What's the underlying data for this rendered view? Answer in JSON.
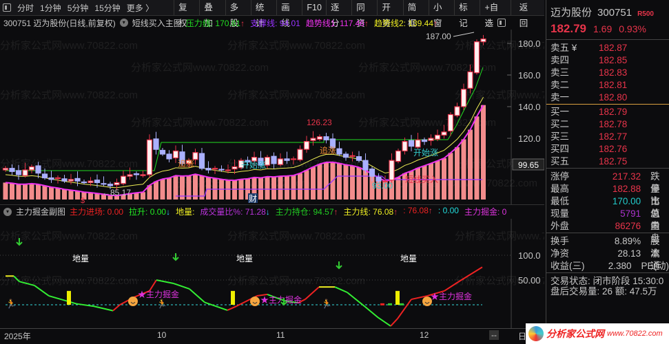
{
  "toolbar": {
    "left": [
      "分时",
      "1分钟",
      "5分钟",
      "15分钟",
      "更多 〉"
    ],
    "buttons": [
      "复权",
      "叠加",
      "多股",
      "统计",
      "画线",
      "F10",
      "逐分",
      "同资",
      "开资",
      "简框",
      "小窗",
      "标记",
      "+自选",
      "返回"
    ]
  },
  "title": {
    "stock": "300751 迈为股份(日线,前复权)",
    "indicator": "短线买入主图",
    "items": [
      {
        "label": "压力线: 170.81",
        "color": "#22dd22",
        "arrow": "↑"
      },
      {
        "label": "支撑线: 94.01",
        "color": "#9933ff",
        "arrow": ""
      },
      {
        "label": "趋势线1: 117.46",
        "color": "#ee33ee",
        "arrow": "↑"
      },
      {
        "label": "趋势线2: 139.44",
        "color": "#eeee22",
        "arrow": "↑"
      }
    ]
  },
  "sub": {
    "indicator": "主力掘金副图",
    "items": [
      {
        "label": "主力进场: 0.00",
        "color": "#ee2222",
        "arrow": ""
      },
      {
        "label": "拉升: 0.00",
        "color": "#22ee22",
        "arrow": "↓"
      },
      {
        "label": "地量:",
        "color": "#eeee22",
        "arrow": ""
      },
      {
        "label": "成交量比%: 71.28",
        "color": "#bb33dd",
        "arrow": "↓"
      },
      {
        "label": "主力持仓: 94.57",
        "color": "#22cc22",
        "arrow": "↑"
      },
      {
        "label": "主力线: 76.08",
        "color": "#eeee22",
        "arrow": "↑"
      },
      {
        "label": ": 76.08",
        "color": "#ee2222",
        "arrow": "↑"
      },
      {
        "label": ": 0.00",
        "color": "#22dddd",
        "arrow": ""
      },
      {
        "label": "主力掘金: 0",
        "color": "#dd33dd",
        "arrow": ""
      }
    ]
  },
  "main_chart": {
    "y_ticks": [
      "180.0",
      "160.0",
      "140.0",
      "120.0"
    ],
    "current_label": "99.65",
    "closes": [
      101,
      99,
      97,
      100,
      102,
      98,
      95,
      94,
      95,
      93,
      94,
      93,
      92,
      93,
      92,
      91,
      90,
      92,
      96,
      97,
      97,
      97,
      119,
      113,
      110,
      107,
      112,
      104,
      106,
      111,
      101,
      100,
      101,
      100,
      100,
      102,
      106,
      105,
      108,
      103,
      108,
      104,
      107,
      106,
      107,
      113,
      118,
      120,
      121,
      119,
      114,
      110,
      108,
      109,
      106,
      100,
      96,
      93,
      93,
      106,
      112,
      118,
      115,
      119,
      118,
      120,
      122,
      124,
      135,
      140,
      151,
      162,
      181,
      182.79
    ],
    "annotations": {
      "high_mark": "126.23",
      "low_mark": "←85.17",
      "low2_mark": "93.00",
      "peak_mark": "187.00",
      "buy": "短线买入",
      "chase": "追涨",
      "start": "开始涨",
      "fin": "财",
      "dollar": "$"
    }
  },
  "sub_chart": {
    "y_ticks": [
      "100.0",
      "50.00"
    ],
    "line": [
      [
        0,
        58
      ],
      [
        12,
        58
      ],
      [
        20,
        47
      ],
      [
        42,
        39
      ],
      [
        63,
        18
      ],
      [
        103,
        2
      ],
      [
        128,
        -3
      ],
      [
        156,
        -12
      ],
      [
        166,
        0
      ],
      [
        186,
        15
      ],
      [
        209,
        28
      ],
      [
        219,
        50
      ],
      [
        244,
        43
      ],
      [
        267,
        32
      ],
      [
        289,
        5
      ],
      [
        322,
        -11
      ],
      [
        335,
        -3
      ],
      [
        365,
        18
      ],
      [
        380,
        21
      ],
      [
        405,
        8
      ],
      [
        425,
        4
      ],
      [
        435,
        11
      ],
      [
        455,
        36
      ],
      [
        478,
        36
      ],
      [
        496,
        25
      ],
      [
        521,
        -3
      ],
      [
        541,
        -26
      ],
      [
        559,
        -43
      ],
      [
        569,
        -28
      ],
      [
        589,
        11
      ],
      [
        612,
        18
      ],
      [
        637,
        28
      ],
      [
        657,
        46
      ],
      [
        692,
        76
      ]
    ],
    "label_ground": "地量",
    "label_gold": "★主力掘金"
  },
  "date_axis": [
    "2025年",
    "10",
    "11",
    "12",
    "--",
    "日"
  ],
  "quote": {
    "name": "迈为股份",
    "code": "300751",
    "badge": "R500",
    "price": "182.79",
    "change": "1.69",
    "pct": "0.93%",
    "asks": [
      [
        "卖五 ¥",
        "182.87"
      ],
      [
        "卖四",
        "182.85"
      ],
      [
        "卖三",
        "182.83"
      ],
      [
        "卖二",
        "182.81"
      ],
      [
        "卖一",
        "182.80"
      ]
    ],
    "bids": [
      [
        "买一",
        "182.79"
      ],
      [
        "买二",
        "182.78"
      ],
      [
        "买三",
        "182.77"
      ],
      [
        "买四",
        "182.76"
      ],
      [
        "买五",
        "182.75"
      ]
    ],
    "stats": [
      [
        "涨停",
        "217.32",
        "跌停",
        "#e8344a"
      ],
      [
        "最高",
        "182.88",
        "量比",
        "#e8344a"
      ],
      [
        "最低",
        "170.00",
        "市值",
        "#22cccc"
      ],
      [
        "现量",
        "5791",
        "总量",
        "#aa33cc"
      ],
      [
        "外盘",
        "86276",
        "内盘",
        "#e8344a"
      ]
    ],
    "stats2": [
      [
        "换手",
        "8.89%",
        "股本"
      ],
      [
        "净资",
        "28.13",
        "流通"
      ],
      [
        "收益(三)",
        "2.380",
        "PE(动)"
      ]
    ],
    "status": "交易状态: 闭市阶段 15:30:0",
    "after": "盘后交易量: 26  额: 47.5万"
  },
  "watermark": "分析家公式网www.70822.com",
  "logo": "分析家公式网 www.70822.com",
  "colors": {
    "up": "#e8344a",
    "down": "#aab0ff"
  }
}
